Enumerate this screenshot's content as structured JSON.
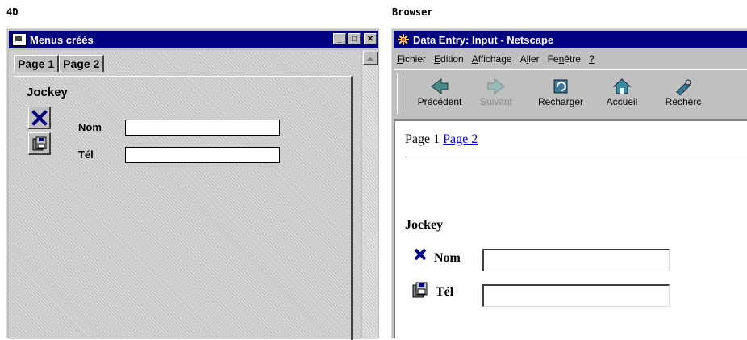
{
  "captions": {
    "left": "4D",
    "right": "Browser"
  },
  "app4d": {
    "title": "Menus créés",
    "window_buttons": [
      "_",
      "□",
      "✕"
    ],
    "tabs": [
      {
        "label": "Page 1",
        "active": true
      },
      {
        "label": "Page 2",
        "active": false
      }
    ],
    "heading": "Jockey",
    "icons": [
      "delete-x-icon",
      "save-disk-icon"
    ],
    "fields": [
      {
        "label": "Nom",
        "value": ""
      },
      {
        "label": "Tél",
        "value": ""
      }
    ]
  },
  "browser": {
    "title": "Data Entry: Input - Netscape",
    "menu": [
      {
        "pre": "",
        "u": "F",
        "post": "ichier"
      },
      {
        "pre": "",
        "u": "E",
        "post": "dition"
      },
      {
        "pre": "",
        "u": "A",
        "post": "ffichage"
      },
      {
        "pre": "A",
        "u": "l",
        "post": "ler"
      },
      {
        "pre": "Fe",
        "u": "n",
        "post": "être"
      },
      {
        "pre": "",
        "u": "?",
        "post": ""
      }
    ],
    "toolbar": [
      {
        "label": "Précédent",
        "icon": "back-arrow-icon",
        "enabled": true
      },
      {
        "label": "Suivant",
        "icon": "forward-arrow-icon",
        "enabled": false
      },
      {
        "label": "Recharger",
        "icon": "reload-icon",
        "enabled": true
      },
      {
        "label": "Accueil",
        "icon": "home-icon",
        "enabled": true
      },
      {
        "label": "Recherc",
        "icon": "search-icon",
        "enabled": true
      }
    ],
    "nav": {
      "current": "Page 1",
      "link": "Page 2"
    },
    "heading": "Jockey",
    "fields": [
      {
        "label": "Nom",
        "value": ""
      },
      {
        "label": "Tél",
        "value": ""
      }
    ]
  }
}
